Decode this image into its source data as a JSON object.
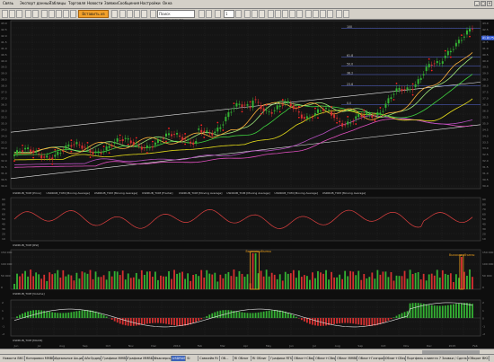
{
  "menu": {
    "items": [
      "Связь",
      "Экспорт данных",
      "Таблицы",
      "Торговля",
      "Новости",
      "Заявки",
      "Сообщения",
      "Настройки",
      "Окна"
    ],
    "window_buttons": [
      "_",
      "□",
      "×"
    ]
  },
  "toolbar": {
    "hotkey_label": "Вставить из",
    "instrument_placeholder": "Поиск инструмента",
    "zoom_value": "1"
  },
  "legends": {
    "price": [
      "USDRUB_TOM [Price]",
      "USDRUB_TOM [Moving Average]",
      "USDRUB_TOM [Moving Average]",
      "USDRUB_TOM [Fractal]",
      "USDRUB_TOM [Moving Average]",
      "USDRUB_TOM [Moving Average]",
      "USDRUB_TOM [Moving Average]",
      "USDRUB_TOM [Moving Average]"
    ],
    "rsi": [
      "USDRUB_TOM [RSI]"
    ],
    "volume": [
      "USDRUB_TOM [Volume]"
    ],
    "macd": [
      "USDRUB_TOM [MACD]"
    ]
  },
  "annotations": {
    "volume_left": "Высокие объемы",
    "volume_right": "Высокие объемы"
  },
  "fib_levels": [
    "100",
    "61.8",
    "50.0",
    "38.2",
    "23.6",
    "0.0"
  ],
  "price_axis": [
    "43.0",
    "42.5",
    "42.0",
    "41.5",
    "41.0",
    "40.5",
    "40.0",
    "39.5",
    "39.0",
    "38.5",
    "38.0",
    "37.5",
    "37.0",
    "36.5",
    "36.0",
    "35.5",
    "35.0",
    "34.5",
    "34.0",
    "33.5",
    "33.0",
    "32.5",
    "32.0",
    "31.5",
    "31.0",
    "30.5",
    "30.0"
  ],
  "price_axis_left": [
    "43.0",
    "42.5",
    "42.0",
    "41.5",
    "41.0",
    "40.5",
    "40.0",
    "39.5",
    "39.0",
    "38.5",
    "38.0",
    "37.5",
    "37.0",
    "36.5",
    "36.0",
    "35.5",
    "35.0",
    "34.5",
    "34.0",
    "33.5",
    "33.0",
    "32.5",
    "32.0",
    "31.5",
    "31.0",
    "30.5",
    "30.0"
  ],
  "price_badge": "41.8175",
  "rsi_axis": [
    "90",
    "80",
    "70",
    "60",
    "50",
    "40",
    "30",
    "20",
    "10"
  ],
  "volume_axis": [
    "150 000",
    "100 000",
    "50 000",
    "0"
  ],
  "macd_axis": [
    "2",
    "1",
    "0",
    "-1",
    "-2"
  ],
  "time_axis": [
    "Jun",
    "Jul",
    "Aug",
    "Sep",
    "Oct",
    "Nov",
    "Dec",
    "2014",
    "Feb",
    "Mar",
    "Apr",
    "May",
    "Jun",
    "Jul",
    "Aug",
    "Sep",
    "Oct",
    "Nov",
    "Dec",
    "2015",
    "Feb"
  ],
  "series_colors": {
    "candle_up": "#34b233",
    "candle_down": "#d63030",
    "fractal": "#ff2222",
    "ma_orange": "#ffb23c",
    "ma_yellow": "#e8df1a",
    "ma_green": "#3fd23f",
    "ma_light_green": "#9ee87a",
    "ma_pink": "#e24fc0",
    "ma_purple": "#b34fbe",
    "channel": "#e8e8e8",
    "fib": "#5b6ee0",
    "rsi": "#e04040",
    "macd": "#e6e6e6",
    "axis_text": "#8c8c8c"
  },
  "tabs": [
    "Новости ВКС",
    "Котировки ММВБ",
    "Идеальное Акций",
    "АйсОрдер",
    "Графики ММВБ",
    "Графики ММВБ2",
    "Фьючерсы",
    "USDRUB",
    "Si",
    "Самкейв RI",
    "Об...",
    "RI Облиг",
    "RI Облиг",
    "Графики RTS",
    "Облиг+Сбер",
    "Облиг+Сбер",
    "Облиг ММВБ",
    "Облиг+Газпром",
    "Облиг+Сбер",
    "Портфель клиента 7 Заявки / Сделки",
    "Оборот ВКС"
  ],
  "active_tab": "USDRUB"
}
